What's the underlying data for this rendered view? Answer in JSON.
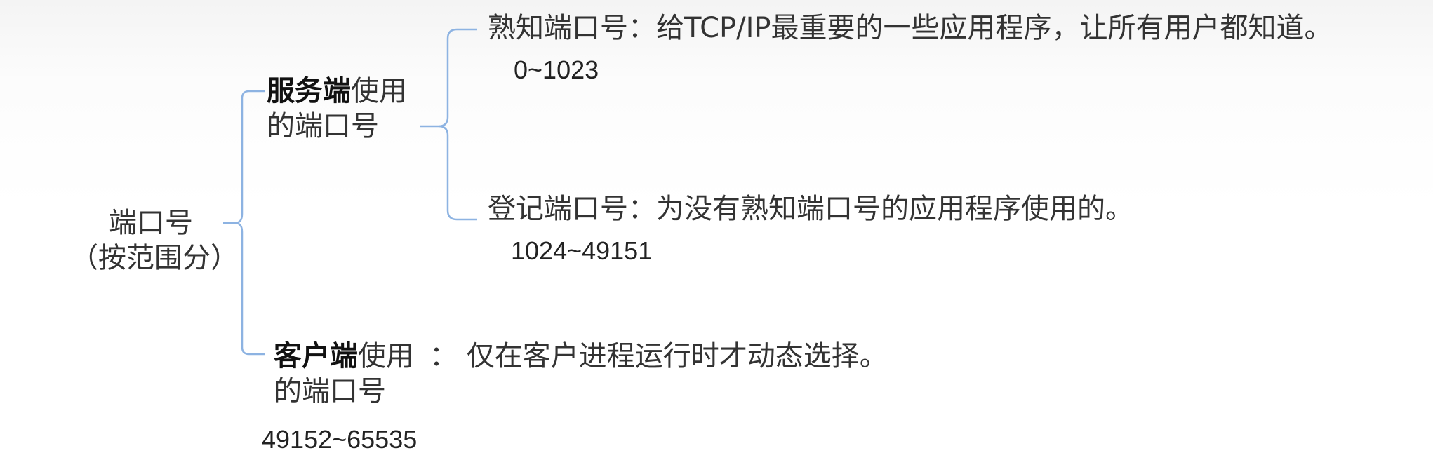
{
  "root": {
    "line1": "端口号",
    "line2": "（按范围分）"
  },
  "server": {
    "bold": "服务端",
    "rest": "使用",
    "line2": "的端口号"
  },
  "well_known": {
    "text": "熟知端口号：给TCP/IP最重要的一些应用程序，让所有用户都知道。",
    "range": "0~1023"
  },
  "registered": {
    "text": "登记端口号：为没有熟知端口号的应用程序使用的。",
    "range": "1024~49151"
  },
  "client": {
    "bold": "客户端",
    "rest": "使用",
    "colon_desc": "：  仅在客户进程运行时才动态选择。",
    "line2": "的端口号",
    "range": "49152~65535"
  },
  "colors": {
    "bracket": "#8db3e2",
    "text": "#333333"
  }
}
